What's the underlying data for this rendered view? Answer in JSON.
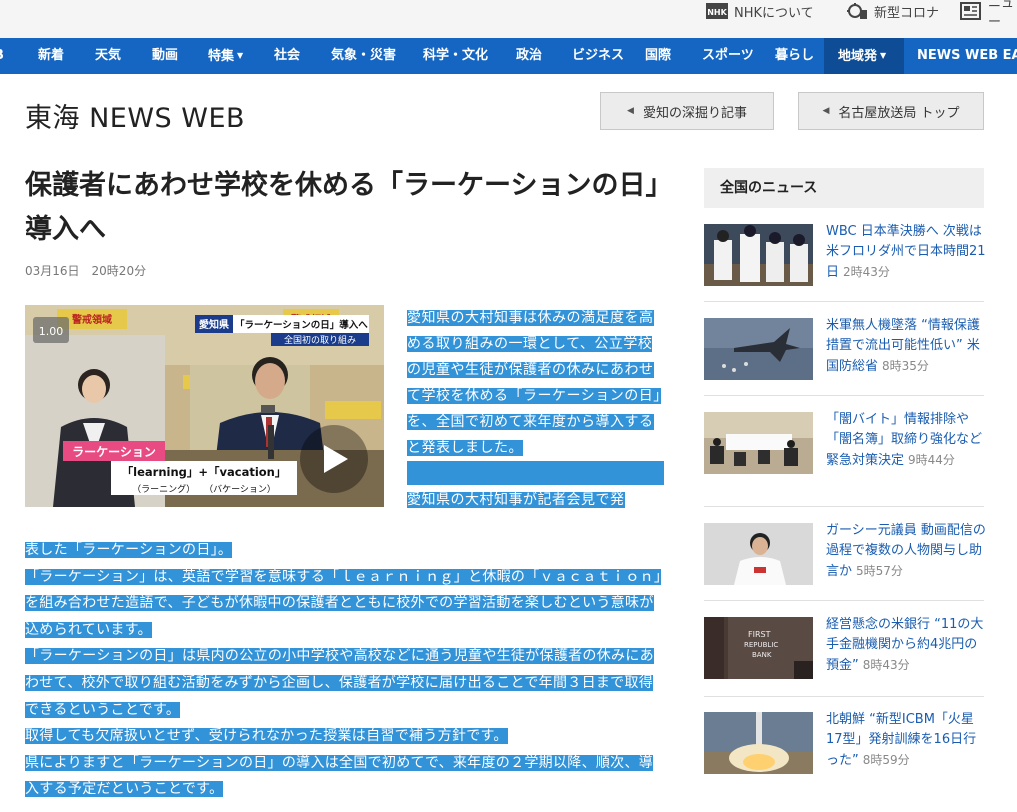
{
  "utility": {
    "about": "NHKについて",
    "corona": "新型コロナ",
    "news": "ニュー"
  },
  "nav": {
    "items": [
      "新着",
      "天気",
      "動画",
      "特集",
      "社会",
      "気象・災害",
      "科学・文化",
      "政治",
      "ビジネス",
      "国際",
      "スポーツ",
      "暮らし",
      "地域発",
      "NEWS WEB EASY"
    ]
  },
  "header": {
    "brand": "東海 NEWS WEB",
    "btn_deep": "愛知の深掘り記事",
    "btn_top": "名古屋放送局 トップ"
  },
  "article": {
    "title": "保護者にあわせ学校を休める「ラーケーションの日」導入へ",
    "date": "03月16日　20時20分",
    "video": {
      "speed": "1.00",
      "caption_pref": "愛知県",
      "caption_main": "「ラーケーションの日」導入へ",
      "caption_sub": "全国初の取り組み",
      "label_word": "ラーケーション",
      "label_formula": "「learning」+「vacation」",
      "label_reading": "（ラーニング）　　（バケーション）"
    },
    "lead": "愛知県の大村知事は休みの満足度を高める取り組みの一環として、公立学校の児童や生徒が保護者の休みにあわせて学校を休める「ラーケーションの日」を、全国で初めて来年度から導入すると発表しました。",
    "caption_start": "愛知県の大村知事が記者会見で発",
    "paragraphs": [
      "表した「ラーケーションの日」。",
      "「ラーケーション」は、英語で学習を意味する「ｌｅａｒｎｉｎｇ」と休暇の「ｖａｃａｔｉｏｎ」を組み合わせた造語で、子どもが休暇中の保護者とともに校外での学習活動を楽しむという意味が込められています。",
      "「ラーケーションの日」は県内の公立の小中学校や高校などに通う児童や生徒が保護者の休みにあわせて、校外で取り組む活動をみずから企画し、保護者が学校に届け出ることで年間３日まで取得できるということです。",
      "取得しても欠席扱いとせず、受けられなかった授業は自習で補う方針です。",
      "県によりますと「ラーケーションの日」の導入は全国で初めてで、来年度の２学期以降、順次、導入する予定だということです。"
    ]
  },
  "sidebar": {
    "heading": "全国のニュース",
    "items": [
      {
        "title": "WBC 日本準決勝へ 次戦は米フロリダ州で日本時間21日",
        "time": "2時43分"
      },
      {
        "title": "米軍無人機墜落 “情報保護措置で流出可能性低い” 米国防総省",
        "time": "8時35分"
      },
      {
        "title": "「闇バイト」情報排除や「闇名簿」取締り強化など緊急対策決定",
        "time": "9時44分"
      },
      {
        "title": "ガーシー元議員 動画配信の過程で複数の人物関与し助言か",
        "time": "5時57分"
      },
      {
        "title": "経営懸念の米銀行 “11の大手金融機関から約4兆円の預金”",
        "time": "8時43分"
      },
      {
        "title": "北朝鮮 “新型ICBM「火星17型」発射訓練を16日行った”",
        "time": "8時59分"
      }
    ]
  },
  "colors": {
    "nav_blue": "#1466c2",
    "selection": "#3293d8",
    "link": "#1a5db0"
  }
}
